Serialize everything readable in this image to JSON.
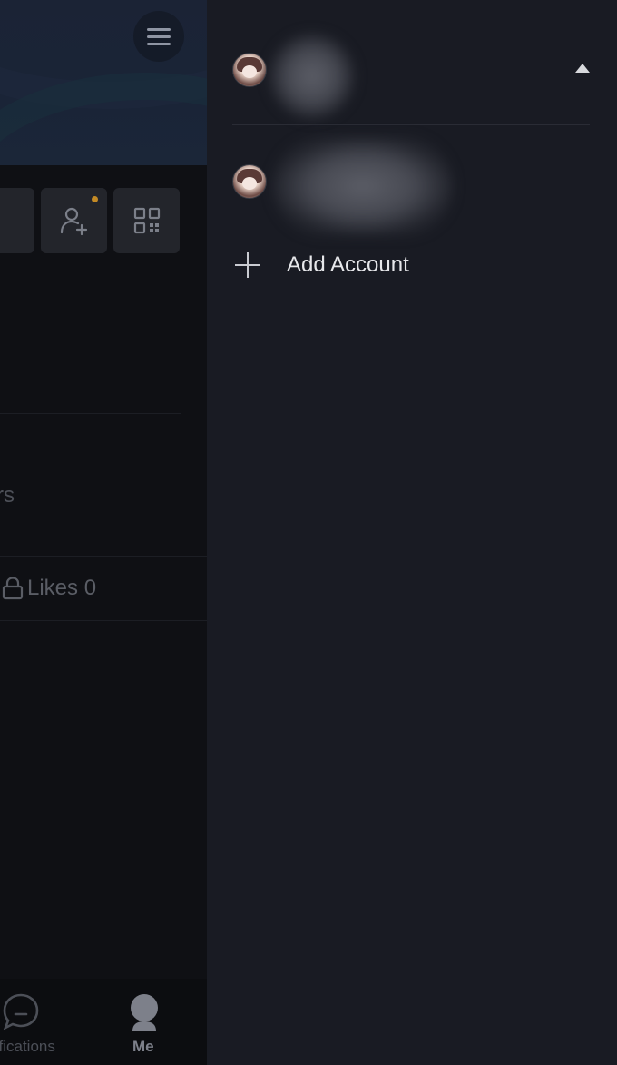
{
  "profile": {
    "followers_fragment": "rs",
    "likes_label": "Likes 0",
    "menu_icon": "hamburger-icon",
    "add_friend_icon": "person-add-icon",
    "qr_icon": "qr-code-icon"
  },
  "bottom_nav": {
    "notifications_label": "tifications",
    "me_label": "Me"
  },
  "drawer": {
    "add_account_label": "Add Account",
    "collapse_icon": "caret-up-icon"
  },
  "colors": {
    "drawer_bg": "#191b23",
    "accent_dot": "#c38a25"
  }
}
